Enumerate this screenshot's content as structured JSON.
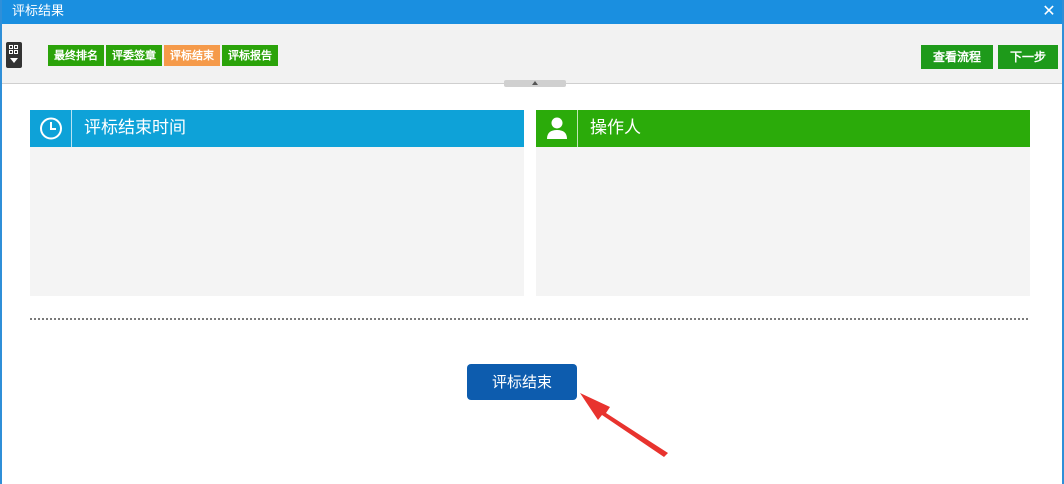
{
  "window": {
    "title": "评标结果",
    "close_glyph": "✕"
  },
  "toolbar": {
    "steps": [
      {
        "label": "最终排名",
        "active": false
      },
      {
        "label": "评委签章",
        "active": false
      },
      {
        "label": "评标结束",
        "active": true
      },
      {
        "label": "评标报告",
        "active": false
      }
    ],
    "view_flow_label": "查看流程",
    "next_label": "下一步"
  },
  "panels": {
    "time": {
      "title": "评标结束时间",
      "icon": "clock-icon",
      "color": "#0ea2d8"
    },
    "operator": {
      "title": "操作人",
      "icon": "user-icon",
      "color": "#2bab0a"
    }
  },
  "actions": {
    "end_label": "评标结束"
  },
  "colors": {
    "titlebar": "#1a8fe0",
    "step_active": "#f59a4a",
    "step": "#2ba30a",
    "end_button": "#0d5cae",
    "annotation_arrow": "#e8332e"
  }
}
